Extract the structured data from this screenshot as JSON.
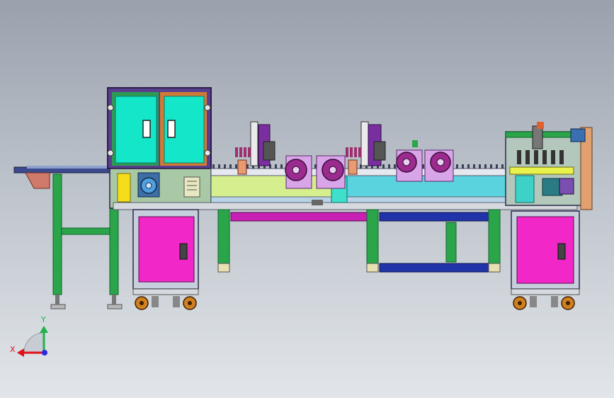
{
  "triad": {
    "x_label": "X",
    "y_label": "Y"
  },
  "colors": {
    "cabinet_magenta": "#f227c8",
    "door_cyan": "#14e6c9",
    "door_frame_orange": "#cf7a35",
    "frame_green": "#2aa54a",
    "beam_blue": "#2133a8",
    "beam_magenta": "#c81fb5",
    "rail_yellowgreen": "#d5ef8f",
    "rail_cyan": "#5bd3de",
    "reel_purple": "#9b2b8e",
    "reel_box_lilac": "#d8a6e8",
    "vertical_plate_purple": "#7a2fa0",
    "triad_red": "#e0101a",
    "triad_green": "#22b24a",
    "triad_blue": "#2a2ad8"
  },
  "icons": [
    "reel-icon",
    "door-handle-icon",
    "caster-wheel-icon",
    "coordinate-triad-icon"
  ]
}
